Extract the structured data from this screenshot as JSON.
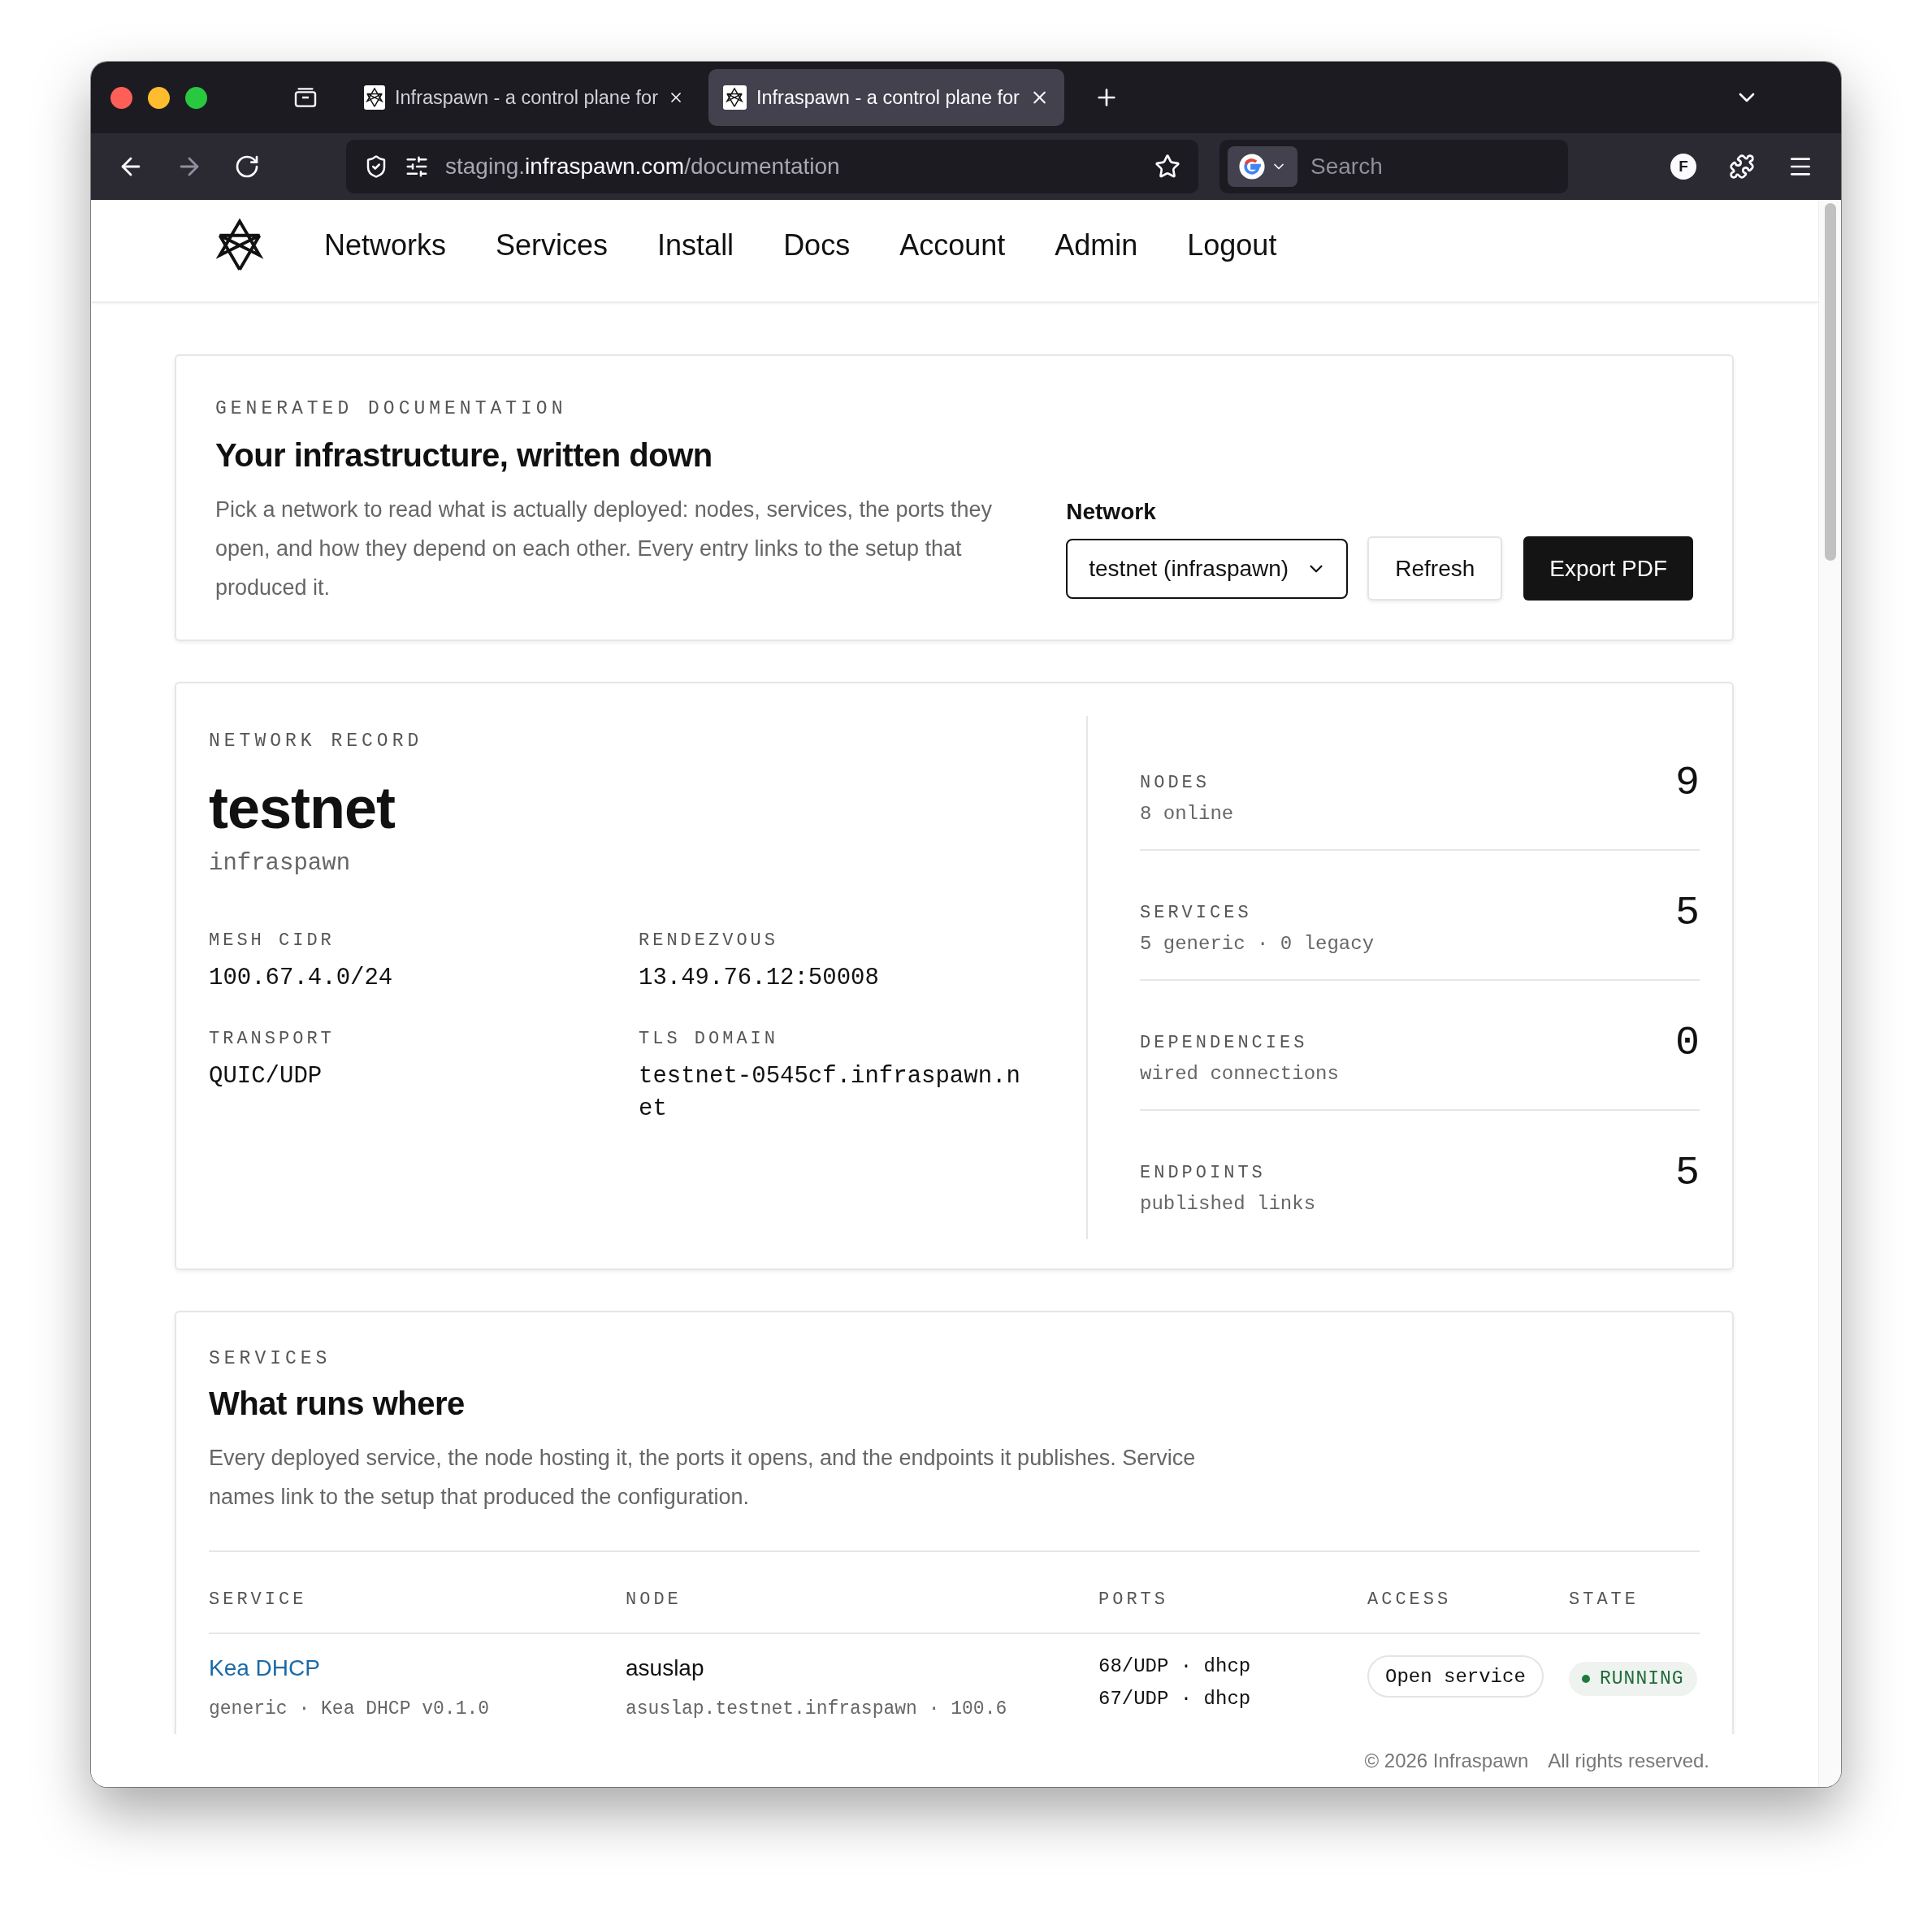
{
  "browser": {
    "tabs": [
      {
        "title": "Infraspawn - a control plane for",
        "selected": false
      },
      {
        "title": "Infraspawn - a control plane for",
        "selected": true
      }
    ],
    "url": {
      "prefix": "staging.",
      "domain": "infraspawn.com",
      "path": "/documentation"
    },
    "search_placeholder": "Search",
    "profile_initial": "F"
  },
  "nav": {
    "items": [
      "Networks",
      "Services",
      "Install",
      "Docs",
      "Account",
      "Admin",
      "Logout"
    ]
  },
  "intro": {
    "eyebrow": "GENERATED DOCUMENTATION",
    "title": "Your infrastructure, written down",
    "description": "Pick a network to read what is actually deployed: nodes, services, the ports they open, and how they depend on each other. Every entry links to the setup that produced it.",
    "network_label": "Network",
    "network_select": "testnet (infraspawn)",
    "buttons": [
      {
        "label": "Refresh",
        "kind": "secondary"
      },
      {
        "label": "Export PDF",
        "kind": "primary"
      }
    ]
  },
  "record": {
    "eyebrow": "NETWORK RECORD",
    "name": "testnet",
    "org": "infraspawn",
    "fields": [
      {
        "label": "MESH CIDR",
        "value": "100.67.4.0/24"
      },
      {
        "label": "RENDEZVOUS",
        "value": "13.49.76.12:50008"
      },
      {
        "label": "TRANSPORT",
        "value": "QUIC/UDP"
      },
      {
        "label": "TLS DOMAIN",
        "value": "testnet-0545cf.infraspawn.net"
      }
    ],
    "stats": [
      {
        "label": "NODES",
        "detail": "8 online",
        "value": "9"
      },
      {
        "label": "SERVICES",
        "detail": "5 generic · 0 legacy",
        "value": "5"
      },
      {
        "label": "DEPENDENCIES",
        "detail": "wired connections",
        "value": "0"
      },
      {
        "label": "ENDPOINTS",
        "detail": "published links",
        "value": "5"
      }
    ]
  },
  "services": {
    "eyebrow": "SERVICES",
    "title": "What runs where",
    "description": "Every deployed service, the node hosting it, the ports it opens, and the endpoints it publishes. Service names link to the setup that produced the configuration.",
    "table": {
      "columns": [
        "SERVICE",
        "NODE",
        "PORTS",
        "ACCESS",
        "STATE"
      ],
      "rows": [
        {
          "service": "Kea DHCP",
          "service_detail": "generic · Kea DHCP v0.1.0",
          "node": "asuslap",
          "node_detail": "asuslap.testnet.infraspawn · 100.6",
          "ports": [
            "68/UDP · dhcp",
            "67/UDP · dhcp"
          ],
          "access": [
            "Open service"
          ],
          "state": {
            "label": "RUNNING",
            "kind": "running"
          }
        }
      ]
    }
  },
  "footer": {
    "copyright": "© 2026 Infraspawn",
    "rights": "All rights reserved."
  }
}
